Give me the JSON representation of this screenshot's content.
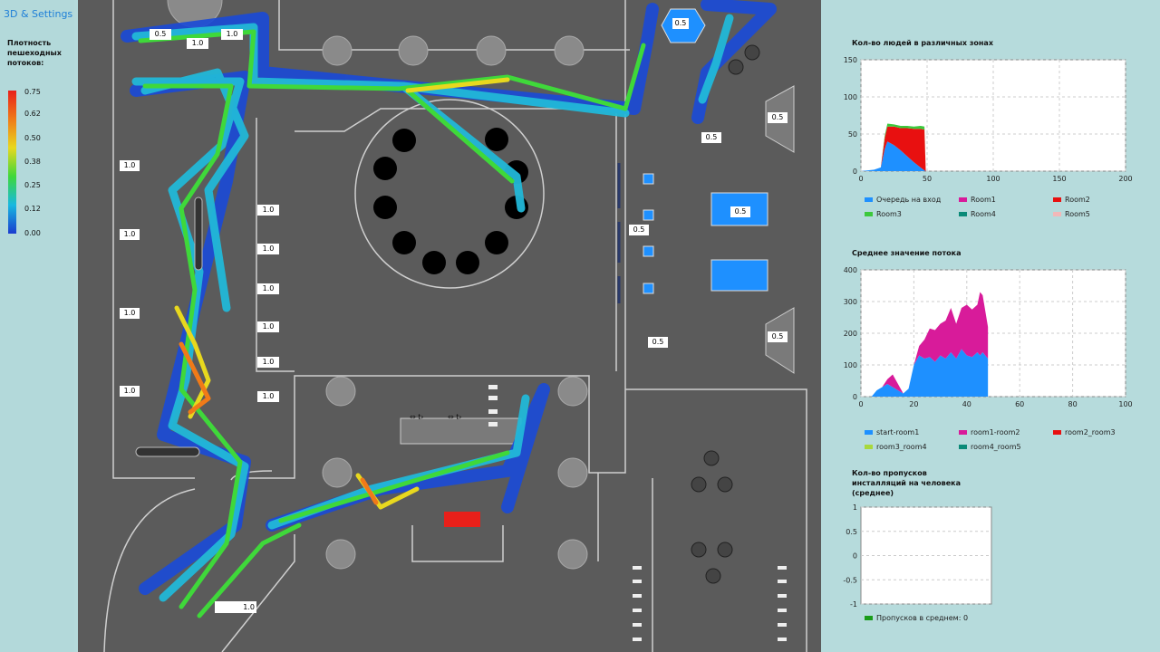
{
  "settings_link": "3D & Settings",
  "density_legend": {
    "title": "Плотность пешеходных потоков:",
    "ticks": [
      "0.75",
      "0.62",
      "0.50",
      "0.38",
      "0.25",
      "0.12",
      "0.00"
    ]
  },
  "map": {
    "signs": [
      "0.5",
      "1.0",
      "1.0",
      "0.5",
      "0.5",
      "0.5",
      "0.5",
      "0.5",
      "0.5",
      "0.5",
      "1.0",
      "1.0",
      "1.0",
      "1.0",
      "1.0",
      "1.0",
      "1.0",
      "1.0",
      "1.0",
      "1.0",
      "0.5",
      "1.0"
    ],
    "turnstile_labels": [
      "⇔ t›",
      "⇔ t›"
    ]
  },
  "colors": {
    "map_bg": "#5b5b5b",
    "panel_bg": "#b6dbdc",
    "accent_blue": "#1e90ff"
  },
  "chart_data": [
    {
      "type": "area",
      "title": "Кол-во людей в различных зонах",
      "xlim": [
        0,
        200
      ],
      "ylim": [
        0,
        150
      ],
      "x_ticks": [
        "0",
        "50",
        "100",
        "150",
        "200"
      ],
      "y_ticks": [
        "0",
        "50",
        "100",
        "150"
      ],
      "legend_entries": [
        {
          "name": "Очередь на вход",
          "color": "#1e90ff"
        },
        {
          "name": "Room1",
          "color": "#d81b9a"
        },
        {
          "name": "Room2",
          "color": "#e81010"
        },
        {
          "name": "Room3",
          "color": "#3cc83c"
        },
        {
          "name": "Room4",
          "color": "#0a8a78"
        },
        {
          "name": "Room5",
          "color": "#f2b8b8"
        }
      ],
      "x": [
        0,
        10,
        15,
        18,
        20,
        25,
        30,
        35,
        40,
        45,
        48,
        49
      ],
      "series": [
        {
          "name": "Очередь на вход",
          "values": [
            0,
            2,
            5,
            30,
            40,
            35,
            28,
            20,
            12,
            5,
            1,
            0
          ]
        },
        {
          "name": "Room2",
          "values": [
            0,
            0,
            0,
            15,
            20,
            25,
            30,
            38,
            45,
            52,
            55,
            0
          ]
        },
        {
          "name": "Room3",
          "values": [
            0,
            0,
            0,
            3,
            4,
            3,
            3,
            3,
            3,
            4,
            4,
            0
          ]
        }
      ]
    },
    {
      "type": "area",
      "title": "Среднее значение потока",
      "xlim": [
        0,
        100
      ],
      "ylim": [
        0,
        400
      ],
      "x_ticks": [
        "0",
        "20",
        "40",
        "60",
        "80",
        "100"
      ],
      "y_ticks": [
        "0",
        "100",
        "200",
        "300",
        "400"
      ],
      "legend_entries": [
        {
          "name": "start-room1",
          "color": "#1e90ff"
        },
        {
          "name": "room1-room2",
          "color": "#d81b9a"
        },
        {
          "name": "room2_room3",
          "color": "#e81010"
        },
        {
          "name": "room3_room4",
          "color": "#a8d83c"
        },
        {
          "name": "room4_room5",
          "color": "#0a8a78"
        }
      ],
      "x": [
        0,
        4,
        6,
        8,
        10,
        12,
        14,
        16,
        18,
        20,
        22,
        24,
        26,
        28,
        30,
        32,
        34,
        36,
        38,
        40,
        42,
        44,
        45,
        46,
        48
      ],
      "series": [
        {
          "name": "start-room1",
          "values": [
            0,
            0,
            20,
            30,
            40,
            30,
            20,
            10,
            25,
            100,
            130,
            120,
            125,
            110,
            130,
            120,
            140,
            120,
            150,
            130,
            125,
            140,
            130,
            140,
            120
          ]
        },
        {
          "name": "room1-room2",
          "values": [
            0,
            0,
            0,
            0,
            15,
            40,
            20,
            0,
            0,
            0,
            30,
            60,
            90,
            100,
            100,
            120,
            140,
            110,
            130,
            160,
            150,
            150,
            200,
            180,
            100
          ]
        }
      ]
    },
    {
      "type": "line",
      "title": "Кол-во пропусков инсталляций на человека (среднее)",
      "xlim": [
        0,
        1
      ],
      "ylim": [
        -1,
        1
      ],
      "y_ticks": [
        "1",
        "0.5",
        "0",
        "-0.5",
        "-1"
      ],
      "legend_entries": [
        {
          "name": "Пропусков в среднем: 0",
          "color": "#1a9c1a"
        }
      ],
      "series": [
        {
          "name": "Пропусков в среднем: 0",
          "values": []
        }
      ]
    }
  ]
}
